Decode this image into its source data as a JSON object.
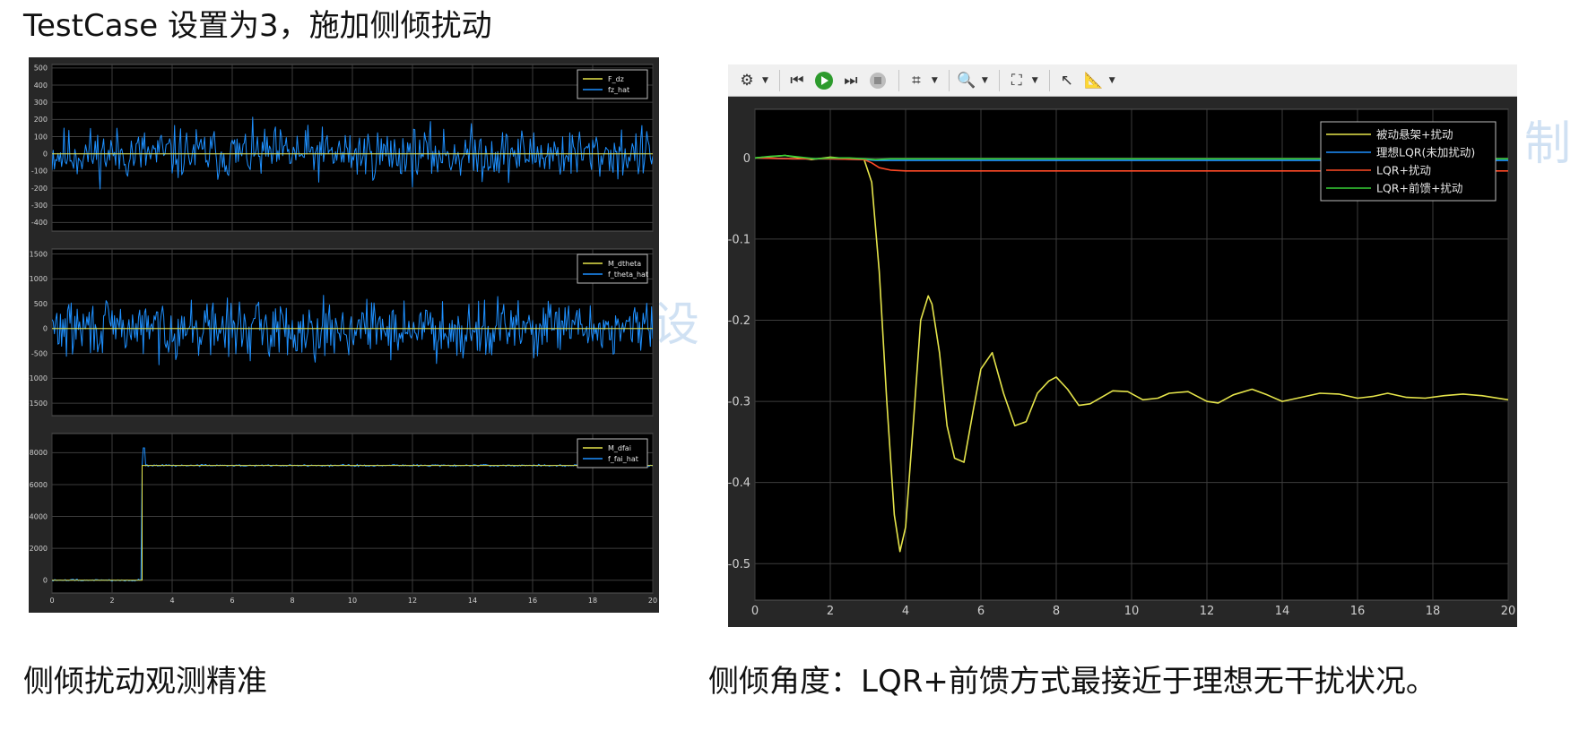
{
  "slide": {
    "title": "TestCase 设置为3，施加侧倾扰动",
    "caption_left": "侧倾扰动观测精准",
    "caption_right": "侧倾角度：LQR+前馈方式最接近于理想无干扰状况。",
    "watermarks": [
      "设",
      "制"
    ]
  },
  "toolbar": {
    "icons": [
      "gear-icon",
      "step-back-icon",
      "run-icon",
      "step-forward-icon",
      "stop-icon",
      "signal-select-icon",
      "zoom-icon",
      "fit-view-icon",
      "cursor-icon",
      "measure-icon"
    ]
  },
  "colors": {
    "plot_bg": "#000000",
    "frame_bg": "#272727",
    "grid": "#3d3d3d",
    "tick_text": "#cfcfcf",
    "yellow": "#e5e44a",
    "blue": "#1e90ff",
    "red": "#ff4a26",
    "green": "#35d035",
    "legend_text": "#e6e6e6"
  },
  "chart_data": [
    {
      "type": "line",
      "panel": "left-top",
      "xlim": [
        0,
        20
      ],
      "ylim": [
        -450,
        520
      ],
      "xticks": [],
      "yticks": [
        500,
        400,
        300,
        200,
        100,
        0,
        -100,
        -200,
        -300,
        -400
      ],
      "ytick_labels": [
        "500",
        "400",
        "300",
        "200",
        "100",
        "0",
        "-100",
        "-200",
        "-300",
        "-400"
      ],
      "grid": true,
      "legend_position": "top-right",
      "series": [
        {
          "name": "F_dz",
          "color": "#e5e44a",
          "kind": "constant",
          "value": 0
        },
        {
          "name": "fz_hat",
          "color": "#1e90ff",
          "kind": "noise",
          "mean": 0,
          "amplitude": 130,
          "clip": [
            -350,
            420
          ],
          "seed": 11
        }
      ]
    },
    {
      "type": "line",
      "panel": "left-middle",
      "xlim": [
        0,
        20
      ],
      "ylim": [
        -1750,
        1600
      ],
      "xticks": [],
      "yticks": [
        1500,
        1000,
        500,
        0,
        -500,
        -1000,
        -1500
      ],
      "ytick_labels": [
        "1500",
        "1000",
        "500",
        "0",
        "-500",
        "-1000",
        "-1500"
      ],
      "grid": true,
      "legend_position": "top-right",
      "series": [
        {
          "name": "M_dtheta",
          "color": "#e5e44a",
          "kind": "constant",
          "value": 0
        },
        {
          "name": "f_theta_hat",
          "color": "#1e90ff",
          "kind": "noise",
          "mean": 0,
          "amplitude": 480,
          "clip": [
            -1350,
            1400
          ],
          "seed": 29
        }
      ]
    },
    {
      "type": "line",
      "panel": "left-bottom",
      "xlim": [
        0,
        20
      ],
      "ylim": [
        -800,
        9200
      ],
      "xticks": [
        0,
        2,
        4,
        6,
        8,
        10,
        12,
        14,
        16,
        18,
        20
      ],
      "xtick_labels": [
        "0",
        "2",
        "4",
        "6",
        "8",
        "10",
        "12",
        "14",
        "16",
        "18",
        "20"
      ],
      "yticks": [
        8000,
        6000,
        4000,
        2000,
        0
      ],
      "ytick_labels": [
        "8000",
        "6000",
        "4000",
        "2000",
        "0"
      ],
      "grid": true,
      "legend_position": "top-right",
      "series": [
        {
          "name": "M_dfai",
          "color": "#e5e44a",
          "kind": "step",
          "x0": 3,
          "before": 0,
          "after": 7200
        },
        {
          "name": "f_fai_hat",
          "color": "#1e90ff",
          "kind": "step-noise",
          "x0": 3,
          "before": 0,
          "after": 7200,
          "amplitude": 80,
          "overshoot": 8300,
          "seed": 47
        }
      ]
    },
    {
      "type": "line",
      "panel": "right",
      "xlim": [
        0,
        20
      ],
      "ylim": [
        -0.545,
        0.06
      ],
      "xticks": [
        0,
        2,
        4,
        6,
        8,
        10,
        12,
        14,
        16,
        18,
        20
      ],
      "xtick_labels": [
        "0",
        "2",
        "4",
        "6",
        "8",
        "10",
        "12",
        "14",
        "16",
        "18",
        "20"
      ],
      "yticks": [
        0,
        -0.1,
        -0.2,
        -0.3,
        -0.4,
        -0.5
      ],
      "ytick_labels": [
        "0",
        "-0.1",
        "-0.2",
        "-0.3",
        "-0.4",
        "-0.5"
      ],
      "grid": true,
      "legend_position": "top-right",
      "series": [
        {
          "name": "被动悬架+扰动",
          "color": "#e5e44a",
          "x": [
            0,
            0.8,
            1.5,
            2.0,
            2.5,
            2.9,
            3.1,
            3.3,
            3.5,
            3.7,
            3.85,
            4.0,
            4.2,
            4.4,
            4.6,
            4.7,
            4.9,
            5.1,
            5.3,
            5.55,
            5.8,
            6.0,
            6.3,
            6.6,
            6.9,
            7.2,
            7.5,
            7.8,
            8.0,
            8.3,
            8.6,
            8.9,
            9.2,
            9.5,
            9.9,
            10.3,
            10.7,
            11.0,
            11.5,
            12.0,
            12.3,
            12.7,
            13.2,
            13.6,
            14.0,
            14.5,
            15.0,
            15.5,
            16.0,
            16.4,
            16.8,
            17.3,
            17.8,
            18.3,
            18.8,
            19.3,
            20.0
          ],
          "y": [
            0.0,
            0.003,
            -0.002,
            0.001,
            -0.001,
            -0.002,
            -0.03,
            -0.14,
            -0.3,
            -0.44,
            -0.485,
            -0.455,
            -0.33,
            -0.2,
            -0.17,
            -0.18,
            -0.24,
            -0.33,
            -0.37,
            -0.375,
            -0.31,
            -0.26,
            -0.24,
            -0.29,
            -0.33,
            -0.325,
            -0.29,
            -0.275,
            -0.27,
            -0.285,
            -0.305,
            -0.303,
            -0.295,
            -0.287,
            -0.288,
            -0.298,
            -0.296,
            -0.29,
            -0.288,
            -0.3,
            -0.302,
            -0.292,
            -0.285,
            -0.292,
            -0.3,
            -0.295,
            -0.29,
            -0.291,
            -0.296,
            -0.294,
            -0.29,
            -0.295,
            -0.296,
            -0.293,
            -0.291,
            -0.293,
            -0.298
          ]
        },
        {
          "name": "理想LQR(未加扰动)",
          "color": "#1e90ff",
          "x": [
            0,
            1,
            2,
            2.9,
            3.2,
            3.5,
            5,
            10,
            15,
            20
          ],
          "y": [
            0,
            -0.001,
            -0.001,
            -0.002,
            -0.003,
            -0.003,
            -0.003,
            -0.003,
            -0.003,
            -0.003
          ]
        },
        {
          "name": "LQR+扰动",
          "color": "#ff4a26",
          "x": [
            0,
            1,
            2,
            2.9,
            3.1,
            3.3,
            3.6,
            4.0,
            5,
            10,
            15,
            20
          ],
          "y": [
            0,
            -0.001,
            -0.001,
            -0.002,
            -0.006,
            -0.012,
            -0.015,
            -0.016,
            -0.016,
            -0.016,
            -0.016,
            -0.016
          ]
        },
        {
          "name": "LQR+前馈+扰动",
          "color": "#35d035",
          "x": [
            0,
            0.4,
            0.8,
            1.2,
            1.6,
            2.0,
            2.5,
            2.9,
            3.2,
            3.6,
            5,
            10,
            15,
            20
          ],
          "y": [
            0.0,
            0.002,
            0.003,
            0.001,
            -0.001,
            0.0,
            0.0,
            -0.001,
            -0.002,
            -0.001,
            -0.001,
            -0.001,
            -0.001,
            -0.001
          ]
        }
      ]
    }
  ]
}
